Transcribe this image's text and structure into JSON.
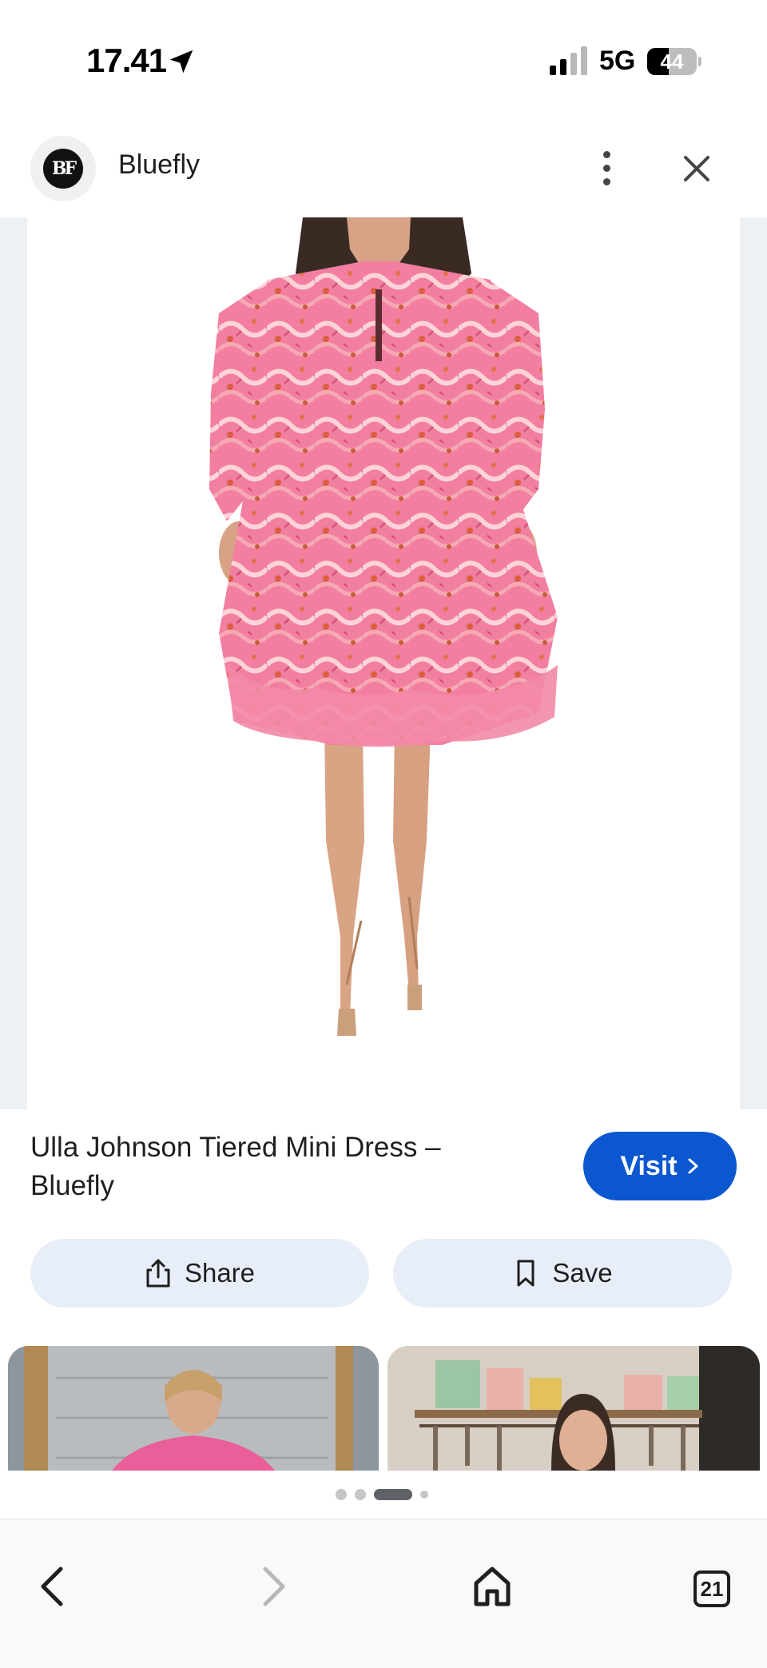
{
  "status_bar": {
    "time": "17.41",
    "network": "5G",
    "battery_text": "44",
    "battery_level_percent": 44
  },
  "site_header": {
    "logo_text": "BF",
    "site_name": "Bluefly",
    "menu_icon": "more-vert-icon",
    "close_icon": "close-icon"
  },
  "product": {
    "title": "Ulla Johnson Tiered Mini Dress – Bluefly",
    "visit_label": "Visit"
  },
  "actions": {
    "share_label": "Share",
    "save_label": "Save"
  },
  "pager": {
    "active_index": 2,
    "count": 4
  },
  "bottom_nav": {
    "back_icon": "chevron-left-icon",
    "forward_icon": "chevron-right-icon",
    "home_icon": "home-icon",
    "tabs_count": "21"
  },
  "colors": {
    "accent": "#0b57d0",
    "tonal_button": "#e8eef8",
    "dress_pink": "#f07fa0"
  }
}
